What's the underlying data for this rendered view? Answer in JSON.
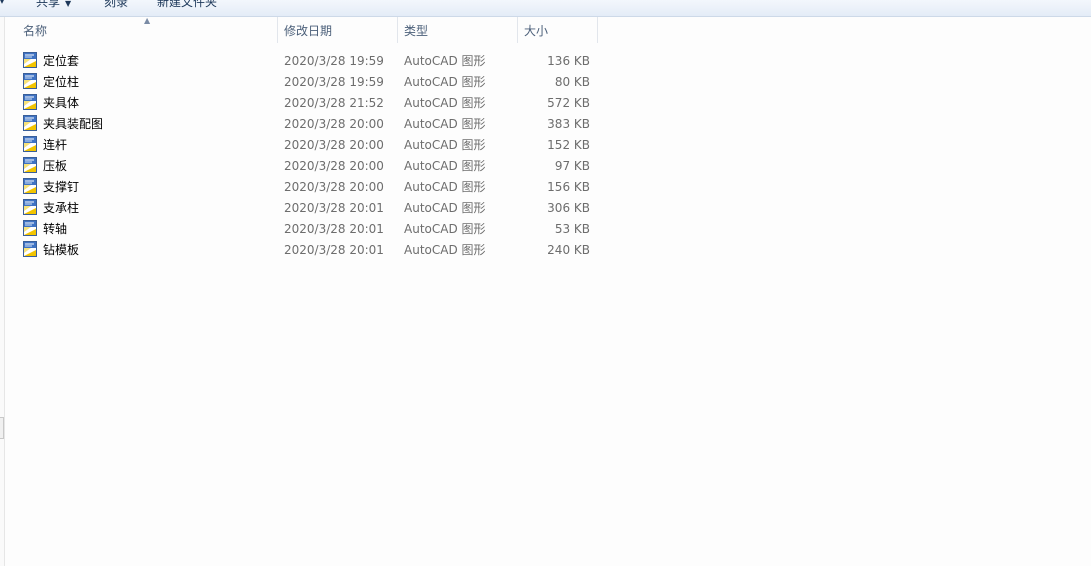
{
  "toolbar": {
    "share_label": "共享",
    "burn_label": "刻录",
    "new_folder_label": "新建文件夹"
  },
  "columns": {
    "name": "名称",
    "date": "修改日期",
    "type": "类型",
    "size": "大小"
  },
  "files": [
    {
      "name": "定位套",
      "date": "2020/3/28 19:59",
      "type": "AutoCAD 图形",
      "size": "136 KB"
    },
    {
      "name": "定位柱",
      "date": "2020/3/28 19:59",
      "type": "AutoCAD 图形",
      "size": "80 KB"
    },
    {
      "name": "夹具体",
      "date": "2020/3/28 21:52",
      "type": "AutoCAD 图形",
      "size": "572 KB"
    },
    {
      "name": "夹具装配图",
      "date": "2020/3/28 20:00",
      "type": "AutoCAD 图形",
      "size": "383 KB"
    },
    {
      "name": "连杆",
      "date": "2020/3/28 20:00",
      "type": "AutoCAD 图形",
      "size": "152 KB"
    },
    {
      "name": "压板",
      "date": "2020/3/28 20:00",
      "type": "AutoCAD 图形",
      "size": "97 KB"
    },
    {
      "name": "支撑钉",
      "date": "2020/3/28 20:00",
      "type": "AutoCAD 图形",
      "size": "156 KB"
    },
    {
      "name": "支承柱",
      "date": "2020/3/28 20:01",
      "type": "AutoCAD 图形",
      "size": "306 KB"
    },
    {
      "name": "转轴",
      "date": "2020/3/28 20:01",
      "type": "AutoCAD 图形",
      "size": "53 KB"
    },
    {
      "name": "钻模板",
      "date": "2020/3/28 20:01",
      "type": "AutoCAD 图形",
      "size": "240 KB"
    }
  ],
  "icons": {
    "file_icon": "autocad-dwg-icon",
    "sort": "sort-ascending-icon"
  }
}
